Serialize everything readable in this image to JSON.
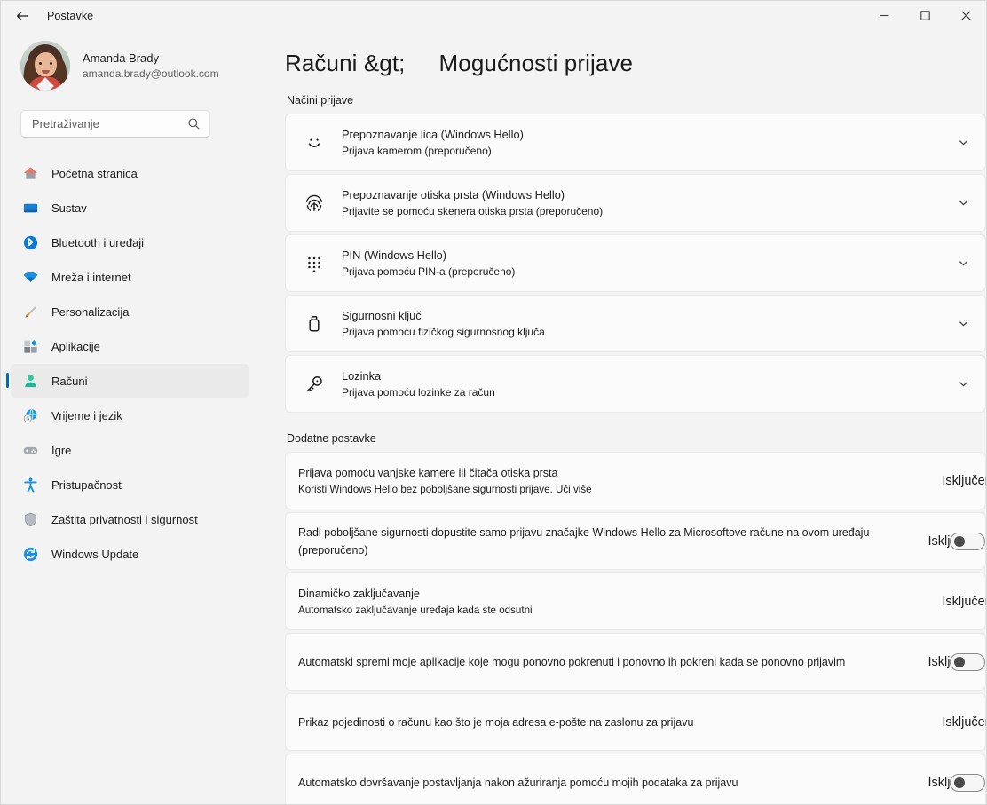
{
  "window": {
    "title": "Postavke",
    "back_icon": "back-arrow-icon",
    "minimize_label": "Minimiziraj",
    "maximize_label": "Maksimiziraj",
    "close_label": "Zatvori"
  },
  "account": {
    "name": "Amanda Brady",
    "email": "amanda.brady@outlook.com",
    "avatar_alt": "Amanda Brady"
  },
  "search": {
    "placeholder": "Pretraživanje",
    "value": "",
    "icon": "search-icon"
  },
  "sidebar": {
    "items": [
      {
        "label": "Početna stranica",
        "icon": "home-icon",
        "selected": false
      },
      {
        "label": "Sustav",
        "icon": "system-icon",
        "selected": false
      },
      {
        "label": "Bluetooth i uređaji",
        "icon": "bluetooth-icon",
        "selected": false
      },
      {
        "label": "Mreža i internet",
        "icon": "network-icon",
        "selected": false
      },
      {
        "label": "Personalizacija",
        "icon": "brush-icon",
        "selected": false
      },
      {
        "label": "Aplikacije",
        "icon": "apps-icon",
        "selected": false
      },
      {
        "label": "Računi",
        "icon": "accounts-icon",
        "selected": true
      },
      {
        "label": "Vrijeme i jezik",
        "icon": "time-language-icon",
        "selected": false
      },
      {
        "label": "Igre",
        "icon": "gaming-icon",
        "selected": false
      },
      {
        "label": "Pristupačnost",
        "icon": "accessibility-icon",
        "selected": false
      },
      {
        "label": "Zaštita privatnosti i sigurnost",
        "icon": "shield-icon",
        "selected": false
      },
      {
        "label": "Windows Update",
        "icon": "update-icon",
        "selected": false
      }
    ]
  },
  "main": {
    "breadcrumb_parent": "Računi &gt;",
    "breadcrumb_current": "Mogućnosti prijave",
    "sections": [
      {
        "label": "Načini prijave"
      },
      {
        "label": "Dodatne postavke"
      }
    ],
    "signin_methods": [
      {
        "title": "Prepoznavanje lica (Windows Hello)",
        "subtitle": "Prijava kamerom (preporučeno)",
        "icon": "face-recognition-icon",
        "chevron": "chevron-down-icon"
      },
      {
        "title": "Prepoznavanje otiska prsta (Windows Hello)",
        "subtitle": "Prijavite se pomoću skenera otiska prsta (preporučeno)",
        "icon": "fingerprint-icon",
        "chevron": "chevron-down-icon"
      },
      {
        "title": "PIN (Windows Hello)",
        "subtitle": "Prijava pomoću PIN-a (preporučeno)",
        "icon": "pin-keypad-icon",
        "chevron": "chevron-down-icon"
      },
      {
        "title": "Sigurnosni ključ",
        "subtitle": "Prijava pomoću fizičkog sigurnosnog ključa",
        "icon": "security-key-icon",
        "chevron": "chevron-down-icon"
      },
      {
        "title": "Lozinka",
        "subtitle": "Prijava pomoću lozinke za račun",
        "icon": "password-key-icon",
        "chevron": "chevron-down-icon"
      }
    ],
    "additional_settings": [
      {
        "title": "Prijava pomoću vanjske kamere ili čitača otiska prsta",
        "subtitle": "Koristi Windows Hello bez poboljšane sigurnosti prijave. Uči više",
        "toggle_label": "Isključeno (O",
        "toggle_state": "off",
        "clipped": true
      },
      {
        "title": "Radi poboljšane sigurnosti dopustite samo prijavu značajke Windows Hello za Microsoftove račune na ovom uređaju (preporučeno)",
        "subtitle": "",
        "toggle_label": "Isključeno",
        "toggle_state": "off",
        "clipped": false
      },
      {
        "title": "Dinamičko zaključavanje",
        "subtitle": "Automatsko zaključavanje uređaja kada ste odsutni",
        "toggle_label": "Isključeno (O",
        "toggle_state": "off",
        "clipped": true
      },
      {
        "title": "Automatski spremi moje aplikacije koje mogu ponovno pokrenuti i ponovno ih pokreni kada se ponovno prijavim",
        "subtitle": "",
        "toggle_label": "Isključeno",
        "toggle_state": "off",
        "clipped": false
      },
      {
        "title": "Prikaz pojedinosti o računu kao što je moja adresa e-pošte na zaslonu za prijavu",
        "subtitle": "",
        "toggle_label": "Isključeno (O",
        "toggle_state": "off",
        "clipped": true
      },
      {
        "title": "Automatsko dovršavanje postavljanja nakon ažuriranja pomoću mojih podataka za prijavu",
        "subtitle": "",
        "toggle_label": "Isključeno",
        "toggle_state": "off",
        "clipped": false
      }
    ]
  },
  "colors": {
    "page_background": "#f3f3f3",
    "card_background": "#fbfbfb",
    "accent": "#0067c0",
    "text_primary": "#1b1b1b",
    "text_secondary": "#616161",
    "close_hover": "#e81123"
  }
}
